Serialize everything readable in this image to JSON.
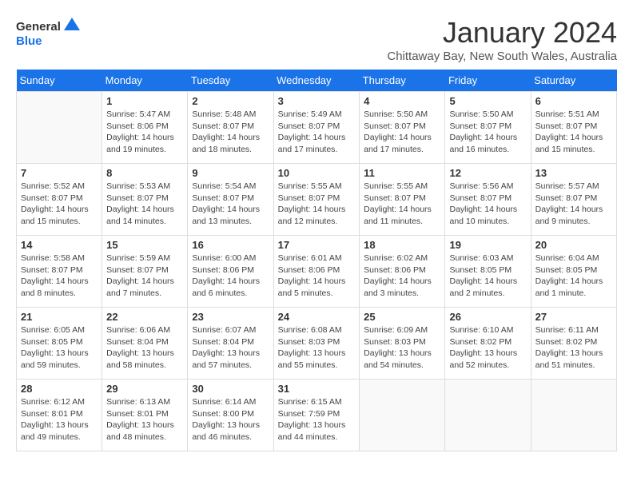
{
  "header": {
    "logo_line1": "General",
    "logo_line2": "Blue",
    "month": "January 2024",
    "location": "Chittaway Bay, New South Wales, Australia"
  },
  "days_of_week": [
    "Sunday",
    "Monday",
    "Tuesday",
    "Wednesday",
    "Thursday",
    "Friday",
    "Saturday"
  ],
  "weeks": [
    [
      {
        "day": "",
        "info": ""
      },
      {
        "day": "1",
        "info": "Sunrise: 5:47 AM\nSunset: 8:06 PM\nDaylight: 14 hours\nand 19 minutes."
      },
      {
        "day": "2",
        "info": "Sunrise: 5:48 AM\nSunset: 8:07 PM\nDaylight: 14 hours\nand 18 minutes."
      },
      {
        "day": "3",
        "info": "Sunrise: 5:49 AM\nSunset: 8:07 PM\nDaylight: 14 hours\nand 17 minutes."
      },
      {
        "day": "4",
        "info": "Sunrise: 5:50 AM\nSunset: 8:07 PM\nDaylight: 14 hours\nand 17 minutes."
      },
      {
        "day": "5",
        "info": "Sunrise: 5:50 AM\nSunset: 8:07 PM\nDaylight: 14 hours\nand 16 minutes."
      },
      {
        "day": "6",
        "info": "Sunrise: 5:51 AM\nSunset: 8:07 PM\nDaylight: 14 hours\nand 15 minutes."
      }
    ],
    [
      {
        "day": "7",
        "info": "Sunrise: 5:52 AM\nSunset: 8:07 PM\nDaylight: 14 hours\nand 15 minutes."
      },
      {
        "day": "8",
        "info": "Sunrise: 5:53 AM\nSunset: 8:07 PM\nDaylight: 14 hours\nand 14 minutes."
      },
      {
        "day": "9",
        "info": "Sunrise: 5:54 AM\nSunset: 8:07 PM\nDaylight: 14 hours\nand 13 minutes."
      },
      {
        "day": "10",
        "info": "Sunrise: 5:55 AM\nSunset: 8:07 PM\nDaylight: 14 hours\nand 12 minutes."
      },
      {
        "day": "11",
        "info": "Sunrise: 5:55 AM\nSunset: 8:07 PM\nDaylight: 14 hours\nand 11 minutes."
      },
      {
        "day": "12",
        "info": "Sunrise: 5:56 AM\nSunset: 8:07 PM\nDaylight: 14 hours\nand 10 minutes."
      },
      {
        "day": "13",
        "info": "Sunrise: 5:57 AM\nSunset: 8:07 PM\nDaylight: 14 hours\nand 9 minutes."
      }
    ],
    [
      {
        "day": "14",
        "info": "Sunrise: 5:58 AM\nSunset: 8:07 PM\nDaylight: 14 hours\nand 8 minutes."
      },
      {
        "day": "15",
        "info": "Sunrise: 5:59 AM\nSunset: 8:07 PM\nDaylight: 14 hours\nand 7 minutes."
      },
      {
        "day": "16",
        "info": "Sunrise: 6:00 AM\nSunset: 8:06 PM\nDaylight: 14 hours\nand 6 minutes."
      },
      {
        "day": "17",
        "info": "Sunrise: 6:01 AM\nSunset: 8:06 PM\nDaylight: 14 hours\nand 5 minutes."
      },
      {
        "day": "18",
        "info": "Sunrise: 6:02 AM\nSunset: 8:06 PM\nDaylight: 14 hours\nand 3 minutes."
      },
      {
        "day": "19",
        "info": "Sunrise: 6:03 AM\nSunset: 8:05 PM\nDaylight: 14 hours\nand 2 minutes."
      },
      {
        "day": "20",
        "info": "Sunrise: 6:04 AM\nSunset: 8:05 PM\nDaylight: 14 hours\nand 1 minute."
      }
    ],
    [
      {
        "day": "21",
        "info": "Sunrise: 6:05 AM\nSunset: 8:05 PM\nDaylight: 13 hours\nand 59 minutes."
      },
      {
        "day": "22",
        "info": "Sunrise: 6:06 AM\nSunset: 8:04 PM\nDaylight: 13 hours\nand 58 minutes."
      },
      {
        "day": "23",
        "info": "Sunrise: 6:07 AM\nSunset: 8:04 PM\nDaylight: 13 hours\nand 57 minutes."
      },
      {
        "day": "24",
        "info": "Sunrise: 6:08 AM\nSunset: 8:03 PM\nDaylight: 13 hours\nand 55 minutes."
      },
      {
        "day": "25",
        "info": "Sunrise: 6:09 AM\nSunset: 8:03 PM\nDaylight: 13 hours\nand 54 minutes."
      },
      {
        "day": "26",
        "info": "Sunrise: 6:10 AM\nSunset: 8:02 PM\nDaylight: 13 hours\nand 52 minutes."
      },
      {
        "day": "27",
        "info": "Sunrise: 6:11 AM\nSunset: 8:02 PM\nDaylight: 13 hours\nand 51 minutes."
      }
    ],
    [
      {
        "day": "28",
        "info": "Sunrise: 6:12 AM\nSunset: 8:01 PM\nDaylight: 13 hours\nand 49 minutes."
      },
      {
        "day": "29",
        "info": "Sunrise: 6:13 AM\nSunset: 8:01 PM\nDaylight: 13 hours\nand 48 minutes."
      },
      {
        "day": "30",
        "info": "Sunrise: 6:14 AM\nSunset: 8:00 PM\nDaylight: 13 hours\nand 46 minutes."
      },
      {
        "day": "31",
        "info": "Sunrise: 6:15 AM\nSunset: 7:59 PM\nDaylight: 13 hours\nand 44 minutes."
      },
      {
        "day": "",
        "info": ""
      },
      {
        "day": "",
        "info": ""
      },
      {
        "day": "",
        "info": ""
      }
    ]
  ]
}
